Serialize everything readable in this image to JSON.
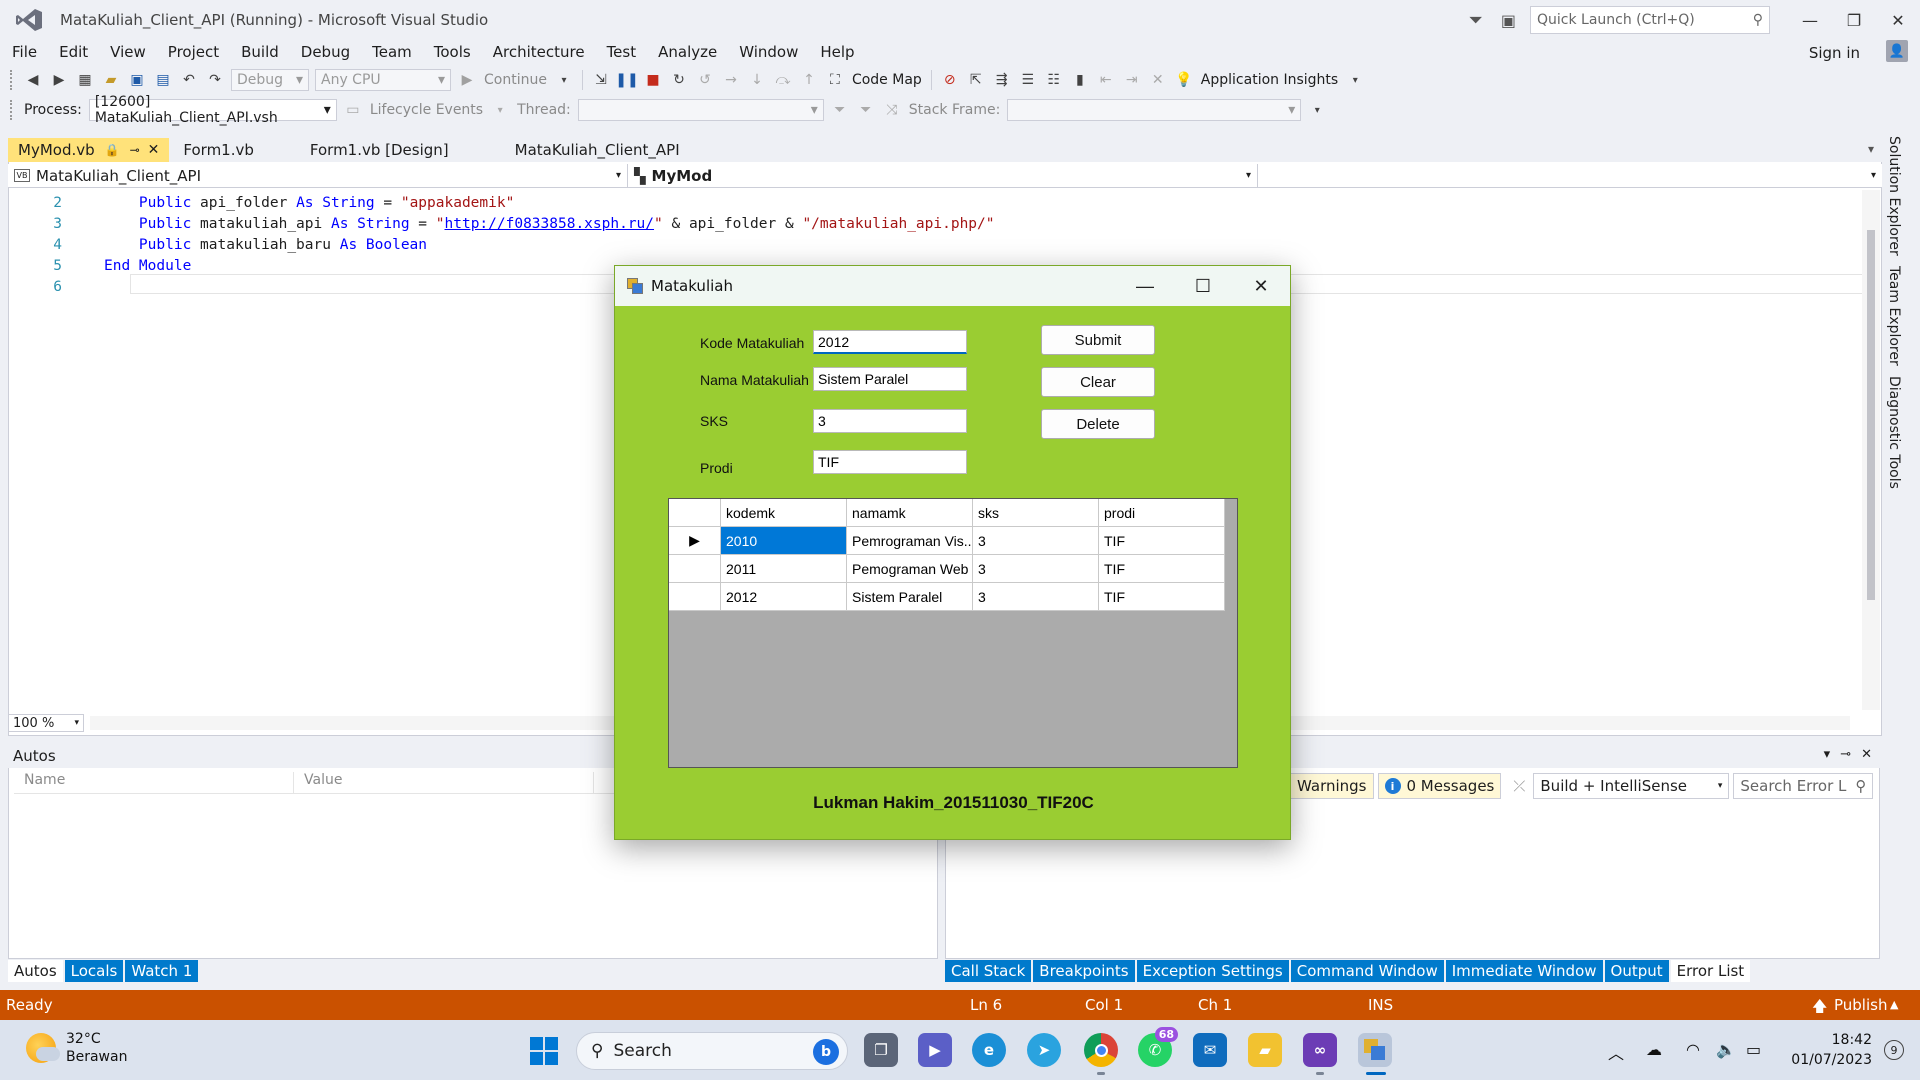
{
  "window": {
    "title": "MataKuliah_Client_API (Running) - Microsoft Visual Studio",
    "quick_launch_placeholder": "Quick Launch (Ctrl+Q)"
  },
  "menu": [
    "File",
    "Edit",
    "View",
    "Project",
    "Build",
    "Debug",
    "Team",
    "Tools",
    "Architecture",
    "Test",
    "Analyze",
    "Window",
    "Help"
  ],
  "sign_in": "Sign in",
  "toolbar": {
    "config": "Debug",
    "platform": "Any CPU",
    "continue": "Continue",
    "code_map": "Code Map",
    "app_insights": "Application Insights",
    "process_label": "Process:",
    "process_value": "[12600] MataKuliah_Client_API.vsh",
    "lifecycle": "Lifecycle Events",
    "thread_label": "Thread:",
    "stack_frame_label": "Stack Frame:"
  },
  "tabs": [
    {
      "label": "MyMod.vb",
      "active": true
    },
    {
      "label": "Form1.vb",
      "active": false
    },
    {
      "label": "Form1.vb [Design]",
      "active": false
    },
    {
      "label": "MataKuliah_Client_API",
      "active": false
    }
  ],
  "nav": {
    "project": "MataKuliah_Client_API",
    "project_icon": "VB",
    "member": "MyMod"
  },
  "code": {
    "lines": [
      {
        "n": "2",
        "kw1": "    Public ",
        "id": "api_folder ",
        "kw2": "As String ",
        "rest": "= ",
        "str": "\"appakademik\""
      },
      {
        "n": "3",
        "kw1": "    Public ",
        "id": "matakuliah_api ",
        "kw2": "As String ",
        "rest": "= ",
        "str": "\"",
        "url": "http://f0833858.xsph.ru/",
        "str2": "\"",
        "tail": " & api_folder & ",
        "str3": "\"/matakuliah_api.php/\""
      },
      {
        "n": "4",
        "kw1": "    Public ",
        "id": "matakuliah_baru ",
        "kw2": "As Boolean"
      },
      {
        "n": "5",
        "kw1": "End Module"
      },
      {
        "n": "6"
      }
    ]
  },
  "zoom": "100 %",
  "autos": {
    "title": "Autos",
    "col_name": "Name",
    "col_value": "Value",
    "tabs": [
      "Autos",
      "Locals",
      "Watch 1"
    ]
  },
  "error_list": {
    "warnings": "Warnings",
    "messages": "0 Messages",
    "build_filter": "Build + IntelliSense",
    "search_placeholder": "Search Error L",
    "tabs": [
      "Call Stack",
      "Breakpoints",
      "Exception Settings",
      "Command Window",
      "Immediate Window",
      "Output",
      "Error List"
    ]
  },
  "side_tabs": [
    "Solution Explorer",
    "Team Explorer",
    "Diagnostic Tools"
  ],
  "status": {
    "ready": "Ready",
    "ln": "Ln 6",
    "col": "Col 1",
    "ch": "Ch 1",
    "ins": "INS",
    "publish": "Publish"
  },
  "dialog": {
    "title": "Matakuliah",
    "fields": {
      "kode_label": "Kode Matakuliah",
      "kode_value": "2012",
      "nama_label": "Nama Matakuliah",
      "nama_value": "Sistem Paralel",
      "sks_label": "SKS",
      "sks_value": "3",
      "prodi_label": "Prodi",
      "prodi_value": "TIF"
    },
    "buttons": {
      "submit": "Submit",
      "clear": "Clear",
      "delete": "Delete"
    },
    "grid": {
      "columns": [
        "kodemk",
        "namamk",
        "sks",
        "prodi"
      ],
      "rows": [
        [
          "2010",
          "Pemrograman Vis...",
          "3",
          "TIF"
        ],
        [
          "2011",
          "Pemograman Web",
          "3",
          "TIF"
        ],
        [
          "2012",
          "Sistem Paralel",
          "3",
          "TIF"
        ]
      ]
    },
    "credit": "Lukman Hakim_201511030_TIF20C"
  },
  "taskbar": {
    "temp": "32°C",
    "weather": "Berawan",
    "search": "Search",
    "whatsapp_badge": "68",
    "time": "18:42",
    "date": "01/07/2023",
    "notifications": "9"
  },
  "colors": {
    "status_bar": "#ca5100",
    "dialog_bg": "#9acd32",
    "selection": "#0078d7",
    "active_tab": "#ffe27a"
  }
}
